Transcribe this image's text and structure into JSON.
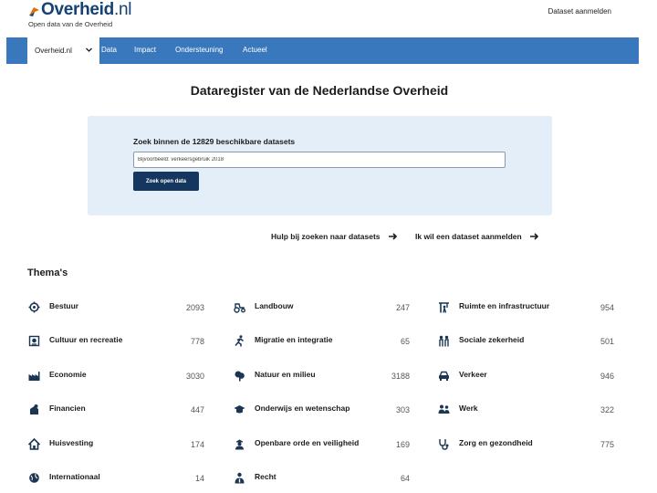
{
  "header": {
    "logo_text": "Overheid",
    "logo_suffix": ".nl",
    "logo_subtitle": "Open data van de Overheid",
    "register_link": "Dataset aanmelden"
  },
  "nav": {
    "selected": "Overheid.nl",
    "items": [
      "Data",
      "Impact",
      "Ondersteuning",
      "Actueel"
    ]
  },
  "page": {
    "title": "Dataregister van de Nederlandse Overheid"
  },
  "search": {
    "label": "Zoek binnen de 12829 beschikbare datasets",
    "placeholder": "Bijvoorbeeld: verkeersgebruik 2018",
    "button": "Zoek open data"
  },
  "links": {
    "help": "Hulp bij zoeken naar datasets",
    "register": "Ik wil een dataset aanmelden"
  },
  "themes": {
    "heading": "Thema's",
    "items": [
      {
        "name": "Bestuur",
        "count": "2093",
        "icon": "gear-icon"
      },
      {
        "name": "Landbouw",
        "count": "247",
        "icon": "tractor-icon"
      },
      {
        "name": "Ruimte en infrastructuur",
        "count": "954",
        "icon": "construction-icon"
      },
      {
        "name": "Cultuur en recreatie",
        "count": "778",
        "icon": "theatre-icon"
      },
      {
        "name": "Migratie en integratie",
        "count": "65",
        "icon": "person-walking-icon"
      },
      {
        "name": "Sociale zekerheid",
        "count": "501",
        "icon": "people-icon"
      },
      {
        "name": "Economie",
        "count": "3030",
        "icon": "factory-icon"
      },
      {
        "name": "Natuur en milieu",
        "count": "3188",
        "icon": "tree-icon"
      },
      {
        "name": "Verkeer",
        "count": "946",
        "icon": "car-icon"
      },
      {
        "name": "Financien",
        "count": "447",
        "icon": "money-icon"
      },
      {
        "name": "Onderwijs en wetenschap",
        "count": "303",
        "icon": "graduation-cap-icon"
      },
      {
        "name": "Werk",
        "count": "322",
        "icon": "workers-icon"
      },
      {
        "name": "Huisvesting",
        "count": "174",
        "icon": "house-icon"
      },
      {
        "name": "Openbare orde en veiligheid",
        "count": "169",
        "icon": "police-icon"
      },
      {
        "name": "Zorg en gezondheid",
        "count": "775",
        "icon": "stethoscope-icon"
      },
      {
        "name": "Internationaal",
        "count": "14",
        "icon": "globe-icon"
      },
      {
        "name": "Recht",
        "count": "64",
        "icon": "judge-icon"
      }
    ]
  },
  "colors": {
    "nav_bg": "#3a78bd",
    "brand_dark": "#154273",
    "panel_bg": "#e4eef8",
    "button_bg": "#14365f"
  }
}
